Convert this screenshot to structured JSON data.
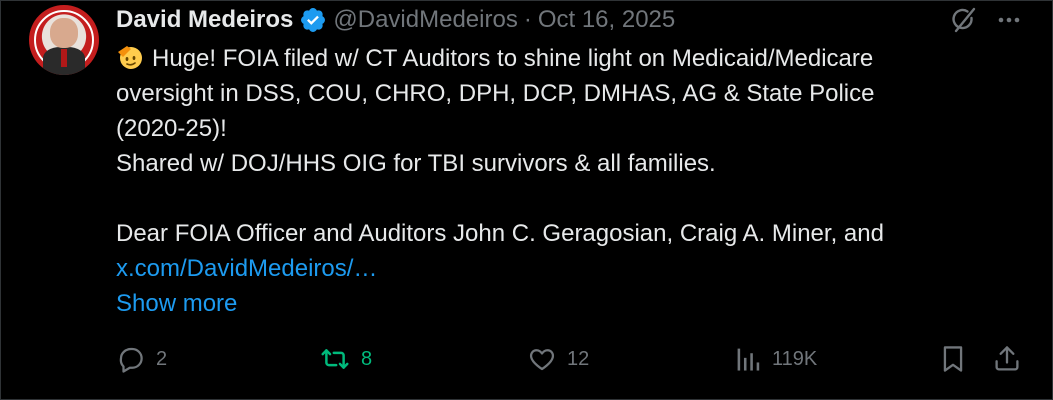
{
  "author": {
    "name": "David Medeiros",
    "handle": "@DavidMedeiros",
    "separator": "·",
    "date": "Oct 16, 2025"
  },
  "tweet": {
    "lines": [
      "Huge!  FOIA filed w/ CT Auditors to shine light on Medicaid/Medicare",
      "oversight in DSS, COU, CHRO, DPH, DCP, DMHAS, AG & State Police",
      "(2020-25)!",
      "Shared w/ DOJ/HHS OIG for TBI survivors & all families.",
      "",
      "Dear FOIA Officer and Auditors John C. Geragosian, Craig A. Miner, and"
    ],
    "link": "x.com/DavidMedeiros/…",
    "show_more": "Show more"
  },
  "actions": {
    "replies": "2",
    "reposts": "8",
    "likes": "12",
    "views": "119K"
  },
  "colors": {
    "accent": "#1d9bf0",
    "repost": "#00ba7c",
    "muted": "#71767b",
    "text": "#e7e9ea"
  },
  "icons": [
    "verified-badge-icon",
    "grok-icon",
    "more-icon",
    "reply-icon",
    "repost-icon",
    "like-icon",
    "views-icon",
    "bookmark-icon",
    "share-icon",
    "saluting-face-emoji"
  ]
}
